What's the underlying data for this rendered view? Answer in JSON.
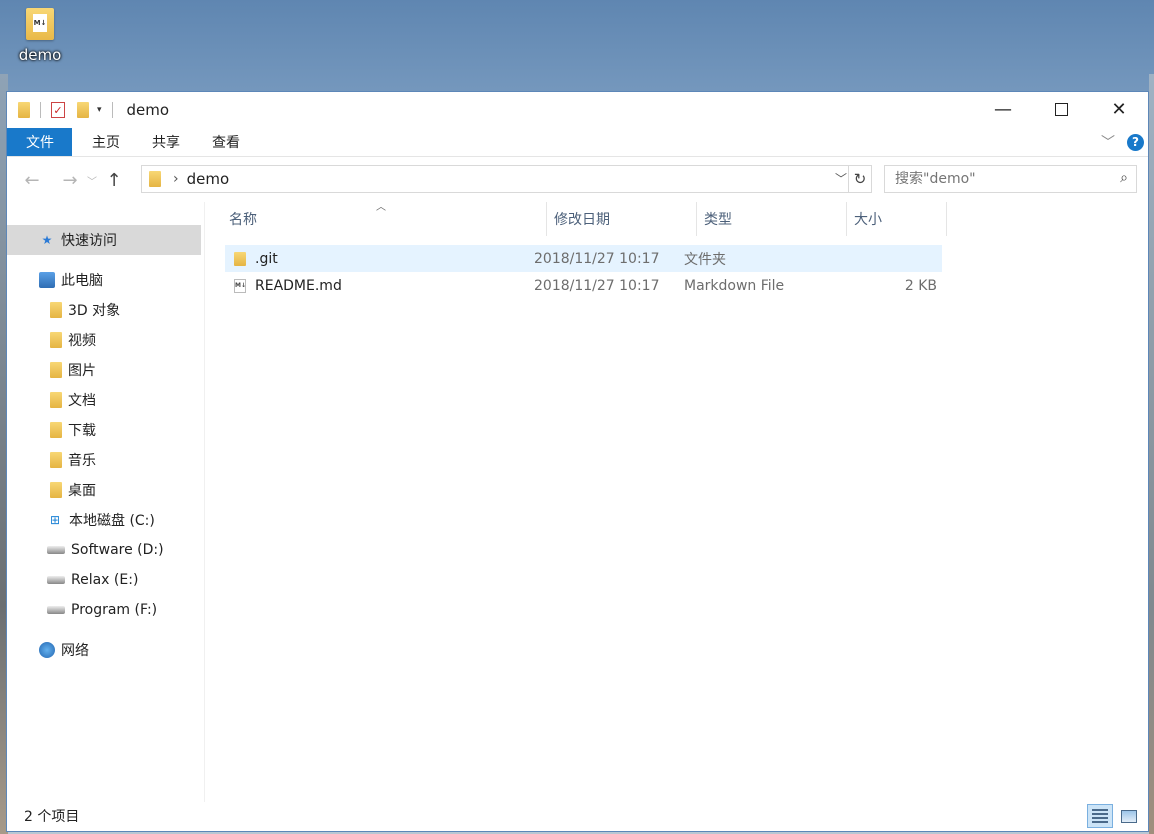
{
  "desktop": {
    "icon_label": "demo"
  },
  "window": {
    "title": "demo",
    "caption": {
      "minimize": "—",
      "maximize": "",
      "close": "✕"
    }
  },
  "ribbon": {
    "tabs": [
      "文件",
      "主页",
      "共享",
      "查看"
    ],
    "help": "?"
  },
  "address": {
    "crumbs": [
      "demo"
    ],
    "search_placeholder": "搜索\"demo\""
  },
  "sidebar": {
    "items": [
      {
        "label": "快速访问",
        "icon": "star-icon"
      },
      {
        "label": "此电脑",
        "icon": "computer-icon"
      },
      {
        "label": "3D 对象",
        "icon": "3d-objects-folder-icon"
      },
      {
        "label": "视频",
        "icon": "video-folder-icon"
      },
      {
        "label": "图片",
        "icon": "pictures-folder-icon"
      },
      {
        "label": "文档",
        "icon": "documents-folder-icon"
      },
      {
        "label": "下载",
        "icon": "downloads-folder-icon"
      },
      {
        "label": "音乐",
        "icon": "music-folder-icon"
      },
      {
        "label": "桌面",
        "icon": "desktop-folder-icon"
      },
      {
        "label": "本地磁盘 (C:)",
        "icon": "windows-drive-icon"
      },
      {
        "label": "Software (D:)",
        "icon": "drive-icon"
      },
      {
        "label": "Relax (E:)",
        "icon": "drive-icon"
      },
      {
        "label": "Program (F:)",
        "icon": "drive-icon"
      },
      {
        "label": "网络",
        "icon": "network-icon"
      }
    ]
  },
  "columns": [
    "名称",
    "修改日期",
    "类型",
    "大小"
  ],
  "files": [
    {
      "name": ".git",
      "modified": "2018/11/27 10:17",
      "type": "文件夹",
      "size": ""
    },
    {
      "name": "README.md",
      "modified": "2018/11/27 10:17",
      "type": "Markdown File",
      "size": "2 KB"
    }
  ],
  "status": {
    "count_text": "2 个项目"
  },
  "colors": {
    "accent": "#1979ca",
    "selected_row": "#e5f3ff",
    "sidebar_selected": "#d9d9d9"
  }
}
